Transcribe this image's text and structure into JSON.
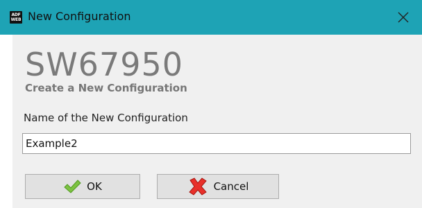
{
  "window": {
    "title": "New Configuration",
    "icon_lines": [
      "ADF",
      "WEB"
    ],
    "icon": "app-logo-icon",
    "close_icon": "close-icon",
    "titlebar_color": "#1ea3b5"
  },
  "header": {
    "product_code": "SW67950",
    "subtitle": "Create a New Configuration"
  },
  "form": {
    "name_label": "Name of the New Configuration",
    "name_value": "Example2"
  },
  "buttons": {
    "ok_label": "OK",
    "ok_icon": "checkmark-icon",
    "cancel_label": "Cancel",
    "cancel_icon": "cross-icon"
  }
}
